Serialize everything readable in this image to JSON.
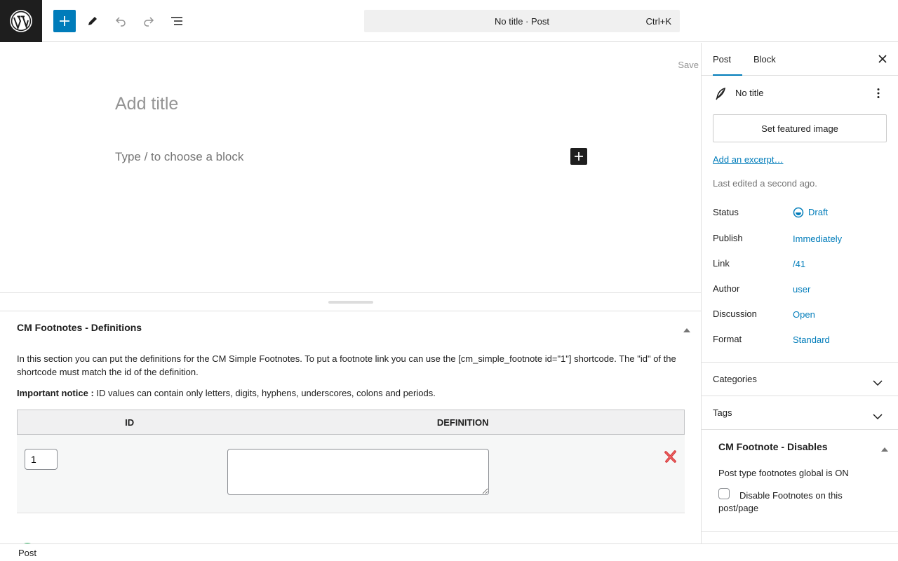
{
  "toolbar": {
    "command_bar": "No title · Post",
    "shortcut": "Ctrl+K"
  },
  "editor": {
    "save_label": "Save",
    "title_placeholder": "Add title",
    "block_placeholder": "Type / to choose a block"
  },
  "metabox": {
    "title": "CM Footnotes - Definitions",
    "description": "In this section you can put the definitions for the CM Simple Footnotes. To put a footnote link you can use the [cm_simple_footnote id=\"1\"] shortcode. The \"id\" of the shortcode must match the id of the definition.",
    "notice_label": "Important notice :",
    "notice_text": " ID values can contain only letters, digits, hyphens, underscores, colons and periods.",
    "table": {
      "headers": [
        "ID",
        "DEFINITION"
      ],
      "rows": [
        {
          "id_value": "1",
          "definition_value": ""
        }
      ]
    }
  },
  "footer": {
    "breadcrumb": "Post"
  },
  "sidebar": {
    "tabs": [
      "Post",
      "Block"
    ],
    "active_tab": "Post",
    "post_title": "No title",
    "featured_image_button": "Set featured image",
    "excerpt_link": "Add an excerpt…",
    "last_edited": "Last edited a second ago.",
    "properties": [
      {
        "label": "Status",
        "value": "Draft"
      },
      {
        "label": "Publish",
        "value": "Immediately"
      },
      {
        "label": "Link",
        "value": "/41"
      },
      {
        "label": "Author",
        "value": "user"
      },
      {
        "label": "Discussion",
        "value": "Open"
      },
      {
        "label": "Format",
        "value": "Standard"
      }
    ],
    "panels": [
      {
        "title": "Categories"
      },
      {
        "title": "Tags"
      }
    ],
    "disables": {
      "title": "CM Footnote - Disables",
      "status_text": "Post type footnotes global is ON",
      "checkbox_label": "Disable Footnotes on this post/page",
      "checked": false
    }
  },
  "colors": {
    "accent": "#007cba",
    "dark": "#1e1e1e",
    "add_green": "#2eb562",
    "delete_red": "#d63638"
  }
}
